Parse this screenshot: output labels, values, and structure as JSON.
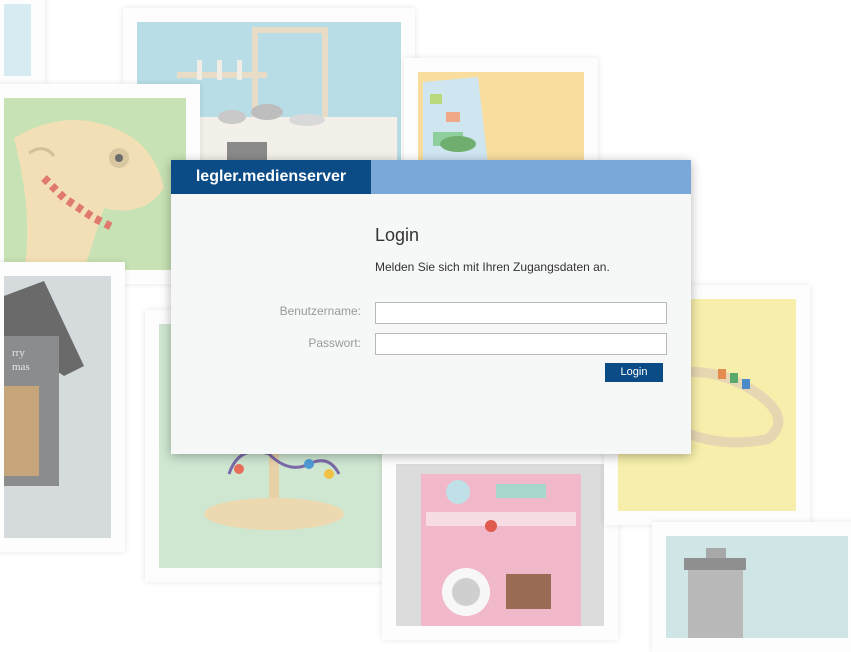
{
  "brand": "legler.medienserver",
  "login": {
    "title": "Login",
    "subtitle": "Melden Sie sich mit Ihren Zugangsdaten an.",
    "username_label": "Benutzername:",
    "username_value": "",
    "password_label": "Passwort:",
    "password_value": "",
    "submit_label": "Login"
  },
  "colors": {
    "brand_bar": "#0b4c86",
    "header_bar": "#7aa9d9",
    "dialog_bg": "#f6f7f7"
  },
  "background_photos": [
    "wooden-kitchen-photo",
    "toy-set-photo",
    "wooden-rocking-horse-photo",
    "christmas-house-lamp-photo",
    "bead-maze-toy-photo",
    "pink-toy-kitchen-photo",
    "wooden-train-track-photo",
    "blender-toy-photo"
  ]
}
